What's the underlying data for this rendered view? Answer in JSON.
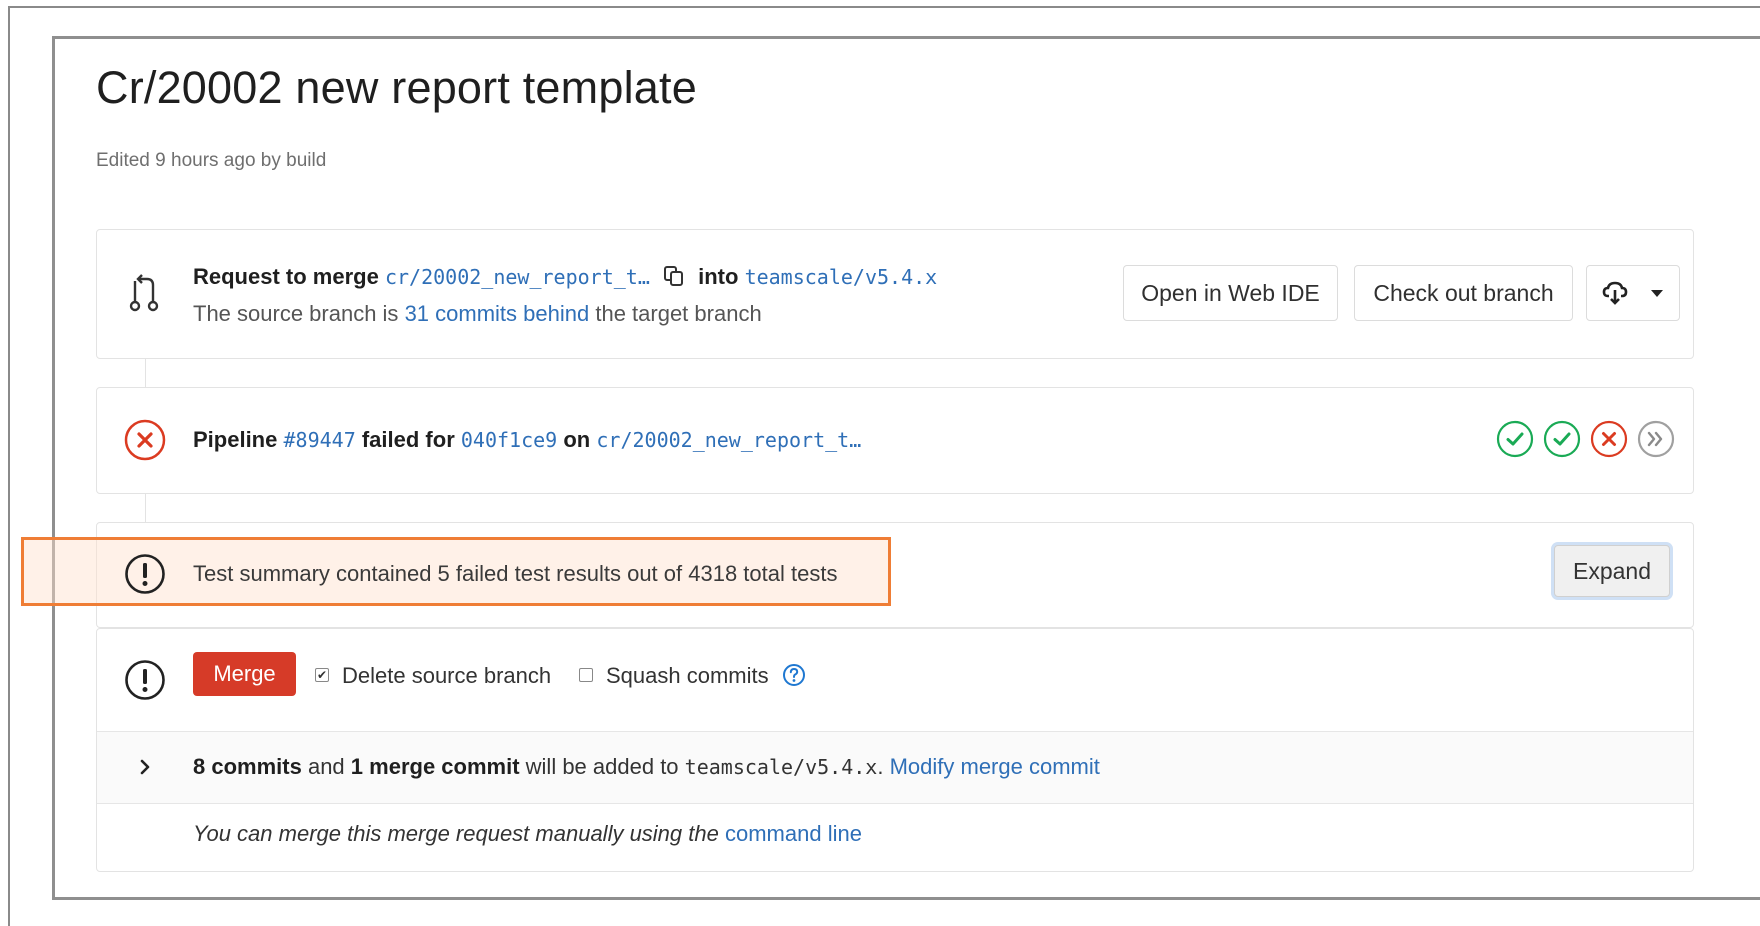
{
  "title": "Cr/20002 new report template",
  "edited": "Edited 9 hours ago by build",
  "merge_request": {
    "request_label": "Request to merge",
    "source_branch": "cr/20002_new_report_t…",
    "into_label": "into",
    "target_branch": "teamscale/v5.4.x",
    "status_prefix": "The source branch is",
    "commits_behind": "31 commits behind",
    "status_suffix": "the target branch",
    "buttons": {
      "web_ide": "Open in Web IDE",
      "checkout": "Check out branch"
    }
  },
  "pipeline": {
    "label": "Pipeline",
    "id": "#89447",
    "failed_for": "failed for",
    "commit": "040f1ce9",
    "on_label": "on",
    "branch": "cr/20002_new_report_t…",
    "stages": [
      "passed",
      "passed",
      "failed",
      "skipped"
    ]
  },
  "test_summary": {
    "text": "Test summary contained 5 failed test results out of 4318 total tests",
    "expand": "Expand"
  },
  "merge_box": {
    "merge_button": "Merge",
    "delete_source": "Delete source branch",
    "delete_checked": true,
    "squash": "Squash commits",
    "squash_checked": false
  },
  "commits_info": {
    "commits": "8 commits",
    "and": "and",
    "merge_commit": "1 merge commit",
    "added_to": "will be added to",
    "target": "teamscale/v5.4.x",
    "period": ".",
    "modify": "Modify merge commit"
  },
  "manual_merge": {
    "text": "You can merge this merge request manually using the",
    "link": "command line"
  },
  "colors": {
    "success": "#1aaa55",
    "failed": "#db3b21",
    "link": "#2f6fb7",
    "highlight": "#ef7d35",
    "merge_button": "#d63b28"
  }
}
